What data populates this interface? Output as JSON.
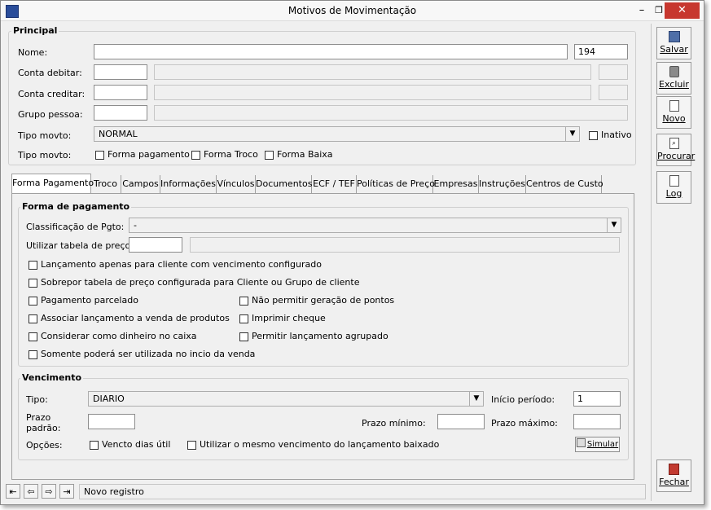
{
  "window": {
    "title": "Motivos de Movimentação"
  },
  "principal": {
    "title": "Principal",
    "nome_label": "Nome:",
    "nome_value": "",
    "codigo": "194",
    "conta_debitar_label": "Conta debitar:",
    "conta_creditar_label": "Conta creditar:",
    "grupo_pessoa_label": "Grupo pessoa:",
    "tipo_movto_label": "Tipo movto:",
    "tipo_movto_value": "NORMAL",
    "inativo_label": "Inativo",
    "tipo_movto2_label": "Tipo movto:",
    "forma_pagamento_label": "Forma pagamento",
    "forma_troco_label": "Forma Troco",
    "forma_baixa_label": "Forma Baixa"
  },
  "tabs": [
    "Forma Pagamento",
    "Troco",
    "Campos",
    "Informações",
    "Vínculos",
    "Documentos",
    "ECF / TEF",
    "Políticas de Preço",
    "Empresas",
    "Instruções",
    "Centros de Custo"
  ],
  "forma_pagamento": {
    "title": "Forma de pagamento",
    "classificacao_label": "Classificação de Pgto:",
    "classificacao_value": "-",
    "tabela_preco_label": "Utilizar tabela de preço:",
    "checks": {
      "c1": "Lançamento apenas para cliente com vencimento configurado",
      "c2": "Sobrepor tabela de preço configurada para Cliente ou Grupo de cliente",
      "c3": "Pagamento parcelado",
      "c4": "Não permitir geração de pontos",
      "c5": "Associar lançamento a venda de produtos",
      "c6": "Imprimir cheque",
      "c7": "Considerar como dinheiro no caixa",
      "c8": "Permitir lançamento agrupado",
      "c9": "Somente poderá ser utilizada no incio da venda"
    }
  },
  "vencimento": {
    "title": "Vencimento",
    "tipo_label": "Tipo:",
    "tipo_value": "DIARIO",
    "inicio_periodo_label": "Início período:",
    "inicio_periodo_value": "1",
    "prazo_padrao_label1": "Prazo",
    "prazo_padrao_label2": "padrão:",
    "prazo_minimo_label": "Prazo mínimo:",
    "prazo_maximo_label": "Prazo máximo:",
    "opcoes_label": "Opções:",
    "vencto_dias_util_label": "Vencto dias útil",
    "mesmo_vencimento_label": "Utilizar o mesmo vencimento do lançamento baixado",
    "simular_label": "Simular"
  },
  "sidebar": {
    "salvar": "Salvar",
    "excluir": "Excluir",
    "novo": "Novo",
    "procurar": "Procurar",
    "log": "Log",
    "fechar": "Fechar"
  },
  "status": {
    "text": "Novo registro"
  }
}
